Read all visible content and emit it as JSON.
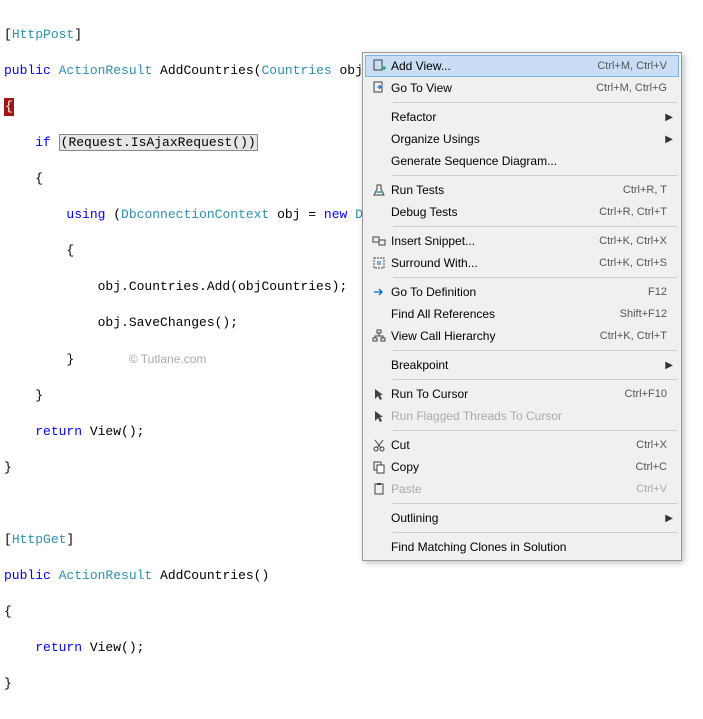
{
  "code": {
    "l1a": "[",
    "l1b": "HttpPost",
    "l1c": "]",
    "l2a": "public",
    "l2b": " ",
    "l2c": "ActionResult",
    "l2d": " AddCountries(",
    "l2e": "Countries",
    "l2f": " objCountries)",
    "l3": "{",
    "l4a": "    ",
    "l4b": "if",
    "l4c": " ",
    "l4d": "(Request.IsAjaxRequest())",
    "l5": "    {",
    "l6a": "        ",
    "l6b": "using",
    "l6c": " (",
    "l6d": "DbconnectionContext",
    "l6e": " obj = ",
    "l6f": "new",
    "l6g": " ",
    "l6h": "Dbco",
    "l7": "        {",
    "l8": "            obj.Countries.Add(objCountries);",
    "l9": "            obj.SaveChanges();",
    "l10": "        }",
    "l10w": "© Tutlane.com",
    "l11": "    }",
    "l12a": "    ",
    "l12b": "return",
    "l12c": " View();",
    "l13": "}",
    "l15a": "[",
    "l15b": "HttpGet",
    "l15c": "]",
    "l16a": "public",
    "l16b": " ",
    "l16c": "ActionResult",
    "l16d": " AddCountries()",
    "l17": "{",
    "l18a": "    ",
    "l18b": "return",
    "l18c": " View();",
    "l19": "}"
  },
  "menu": [
    {
      "icon": "doc-plus",
      "label": "Add View...",
      "shortcut": "Ctrl+M, Ctrl+V",
      "hover": true
    },
    {
      "icon": "doc-arrow",
      "label": "Go To View",
      "shortcut": "Ctrl+M, Ctrl+G"
    },
    {
      "sep": true
    },
    {
      "label": "Refactor",
      "arrow": true
    },
    {
      "label": "Organize Usings",
      "arrow": true
    },
    {
      "label": "Generate Sequence Diagram..."
    },
    {
      "sep": true
    },
    {
      "icon": "flask",
      "label": "Run Tests",
      "shortcut": "Ctrl+R, T"
    },
    {
      "label": "Debug Tests",
      "shortcut": "Ctrl+R, Ctrl+T"
    },
    {
      "sep": true
    },
    {
      "icon": "snippet",
      "label": "Insert Snippet...",
      "shortcut": "Ctrl+K, Ctrl+X"
    },
    {
      "icon": "surround",
      "label": "Surround With...",
      "shortcut": "Ctrl+K, Ctrl+S"
    },
    {
      "sep": true
    },
    {
      "icon": "goto",
      "label": "Go To Definition",
      "shortcut": "F12"
    },
    {
      "label": "Find All References",
      "shortcut": "Shift+F12"
    },
    {
      "icon": "hier",
      "label": "View Call Hierarchy",
      "shortcut": "Ctrl+K, Ctrl+T"
    },
    {
      "sep": true
    },
    {
      "label": "Breakpoint",
      "arrow": true
    },
    {
      "sep": true
    },
    {
      "icon": "cursor",
      "label": "Run To Cursor",
      "shortcut": "Ctrl+F10"
    },
    {
      "icon": "cursor",
      "label": "Run Flagged Threads To Cursor",
      "disabled": true
    },
    {
      "sep": true
    },
    {
      "icon": "cut",
      "label": "Cut",
      "shortcut": "Ctrl+X"
    },
    {
      "icon": "copy",
      "label": "Copy",
      "shortcut": "Ctrl+C"
    },
    {
      "icon": "paste",
      "label": "Paste",
      "shortcut": "Ctrl+V",
      "disabled": true
    },
    {
      "sep": true
    },
    {
      "label": "Outlining",
      "arrow": true
    },
    {
      "sep": true
    },
    {
      "label": "Find Matching Clones in Solution"
    }
  ]
}
